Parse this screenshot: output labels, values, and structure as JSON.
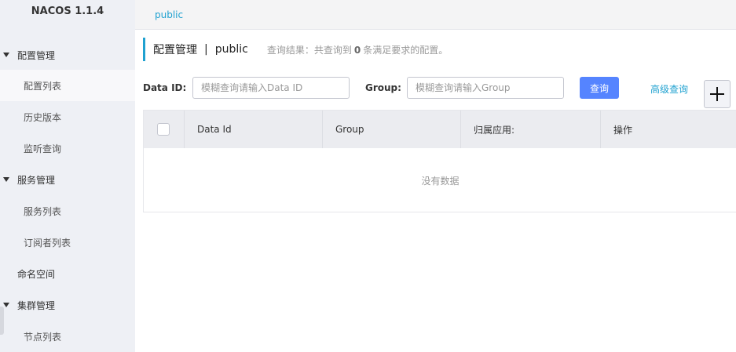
{
  "sidebar": {
    "brand": "NACOS 1.1.4",
    "items": [
      {
        "label": "配置管理"
      },
      {
        "label": "配置列表"
      },
      {
        "label": "历史版本"
      },
      {
        "label": "监听查询"
      },
      {
        "label": "服务管理"
      },
      {
        "label": "服务列表"
      },
      {
        "label": "订阅者列表"
      },
      {
        "label": "命名空间"
      },
      {
        "label": "集群管理"
      },
      {
        "label": "节点列表"
      }
    ]
  },
  "namespace_bar": {
    "current": "public"
  },
  "header": {
    "title": "配置管理",
    "separator": "|",
    "namespace": "public",
    "summary_prefix": "查询结果：共查询到",
    "summary_count": "0",
    "summary_suffix": "条满足要求的配置。"
  },
  "search": {
    "data_id_label": "Data ID:",
    "data_id_placeholder": "模糊查询请输入Data ID",
    "group_label": "Group:",
    "group_placeholder": "模糊查询请输入Group",
    "query_button": "查询",
    "advanced_link": "高级查询"
  },
  "table": {
    "columns": [
      "Data Id",
      "Group",
      "归属应用:",
      "操作"
    ],
    "empty_text": "没有数据"
  },
  "colors": {
    "accent": "#1fa1d0",
    "primary_button": "#5584ff",
    "sidebar_bg": "#eef0f5"
  }
}
